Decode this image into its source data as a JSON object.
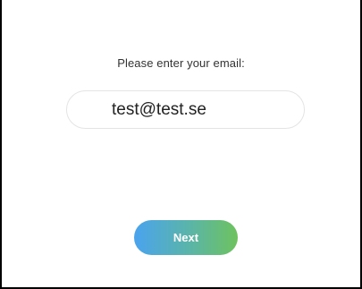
{
  "form": {
    "prompt": "Please enter your email:",
    "email_value": "test@test.se",
    "next_label": "Next"
  },
  "colors": {
    "button_gradient_start": "#4aa3ee",
    "button_gradient_end": "#6ec25e",
    "frame_border": "#000000",
    "input_border": "#e4e4e4"
  }
}
